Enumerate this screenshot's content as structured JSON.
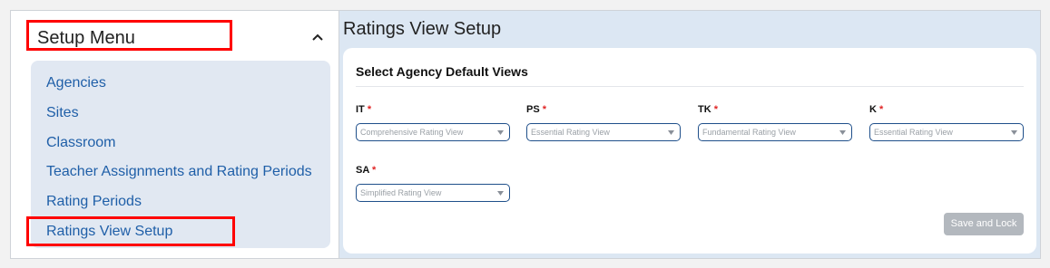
{
  "sidebar": {
    "title": "Setup Menu",
    "items": [
      {
        "label": "Agencies"
      },
      {
        "label": "Sites"
      },
      {
        "label": "Classroom"
      },
      {
        "label": "Teacher Assignments and Rating Periods"
      },
      {
        "label": "Rating Periods"
      },
      {
        "label": "Ratings View Setup"
      }
    ],
    "active_item": "Ratings View Setup",
    "collapse_icon": "chevron-up-icon"
  },
  "main": {
    "page_title": "Ratings View Setup",
    "card": {
      "title": "Select Agency Default Views",
      "fields": [
        {
          "label": "IT",
          "value": "Comprehensive Rating View"
        },
        {
          "label": "PS",
          "value": "Essential Rating View"
        },
        {
          "label": "TK",
          "value": "Fundamental Rating View"
        },
        {
          "label": "K",
          "value": "Essential Rating View"
        },
        {
          "label": "SA",
          "value": "Simplified Rating View"
        }
      ],
      "required_marker": "*",
      "save_button": "Save and Lock"
    }
  },
  "colors": {
    "link": "#1f5fa8",
    "highlight": "#ff0000",
    "panel_bg": "#e1e8f2",
    "main_bg": "#dce7f3",
    "required": "#e02424",
    "button_disabled": "#b3b8be"
  }
}
